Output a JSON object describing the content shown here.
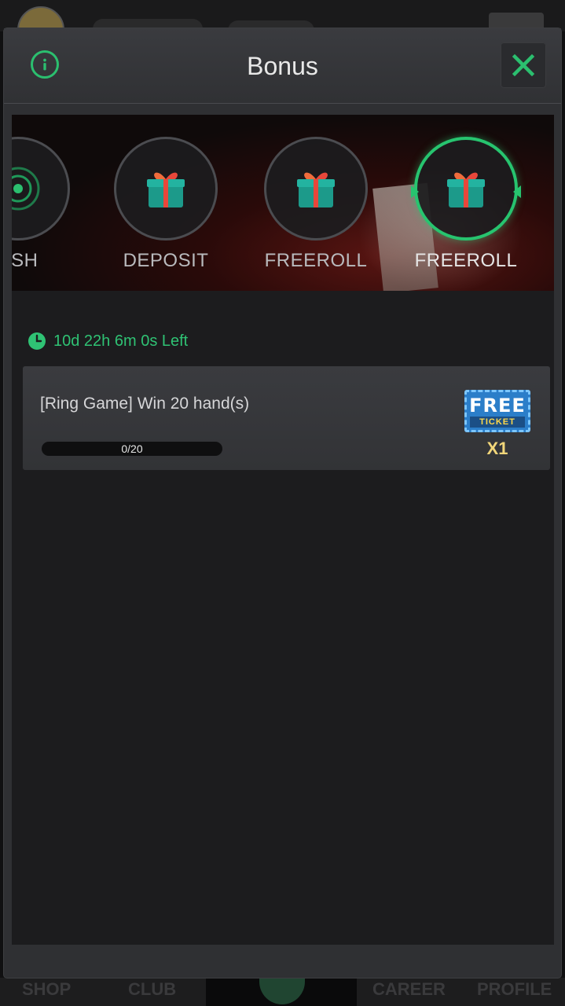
{
  "background_nav": {
    "items": [
      "SHOP",
      "CLUB",
      "CAREER",
      "PROFILE"
    ]
  },
  "modal": {
    "title": "Bonus",
    "info_icon": "info-icon",
    "close_icon": "close-icon"
  },
  "bonus_tabs": [
    {
      "label": "ASH",
      "icon": "radar-icon",
      "active": false
    },
    {
      "label": "DEPOSIT",
      "icon": "gift-icon",
      "active": false
    },
    {
      "label": "FREEROLL",
      "icon": "gift-icon",
      "active": false
    },
    {
      "label": "FREEROLL",
      "icon": "gift-icon",
      "active": true
    }
  ],
  "timer": {
    "icon": "clock-icon",
    "text": "10d 22h 6m 0s Left"
  },
  "task": {
    "description": "[Ring Game] Win 20 hand(s)",
    "progress_text": "0/20",
    "progress_fraction": 0,
    "reward": {
      "ticket_title": "FREE",
      "ticket_subtitle": "TICKET",
      "quantity": "X1"
    }
  },
  "colors": {
    "accent": "#27c46f",
    "reward_gold": "#f2d67a"
  }
}
